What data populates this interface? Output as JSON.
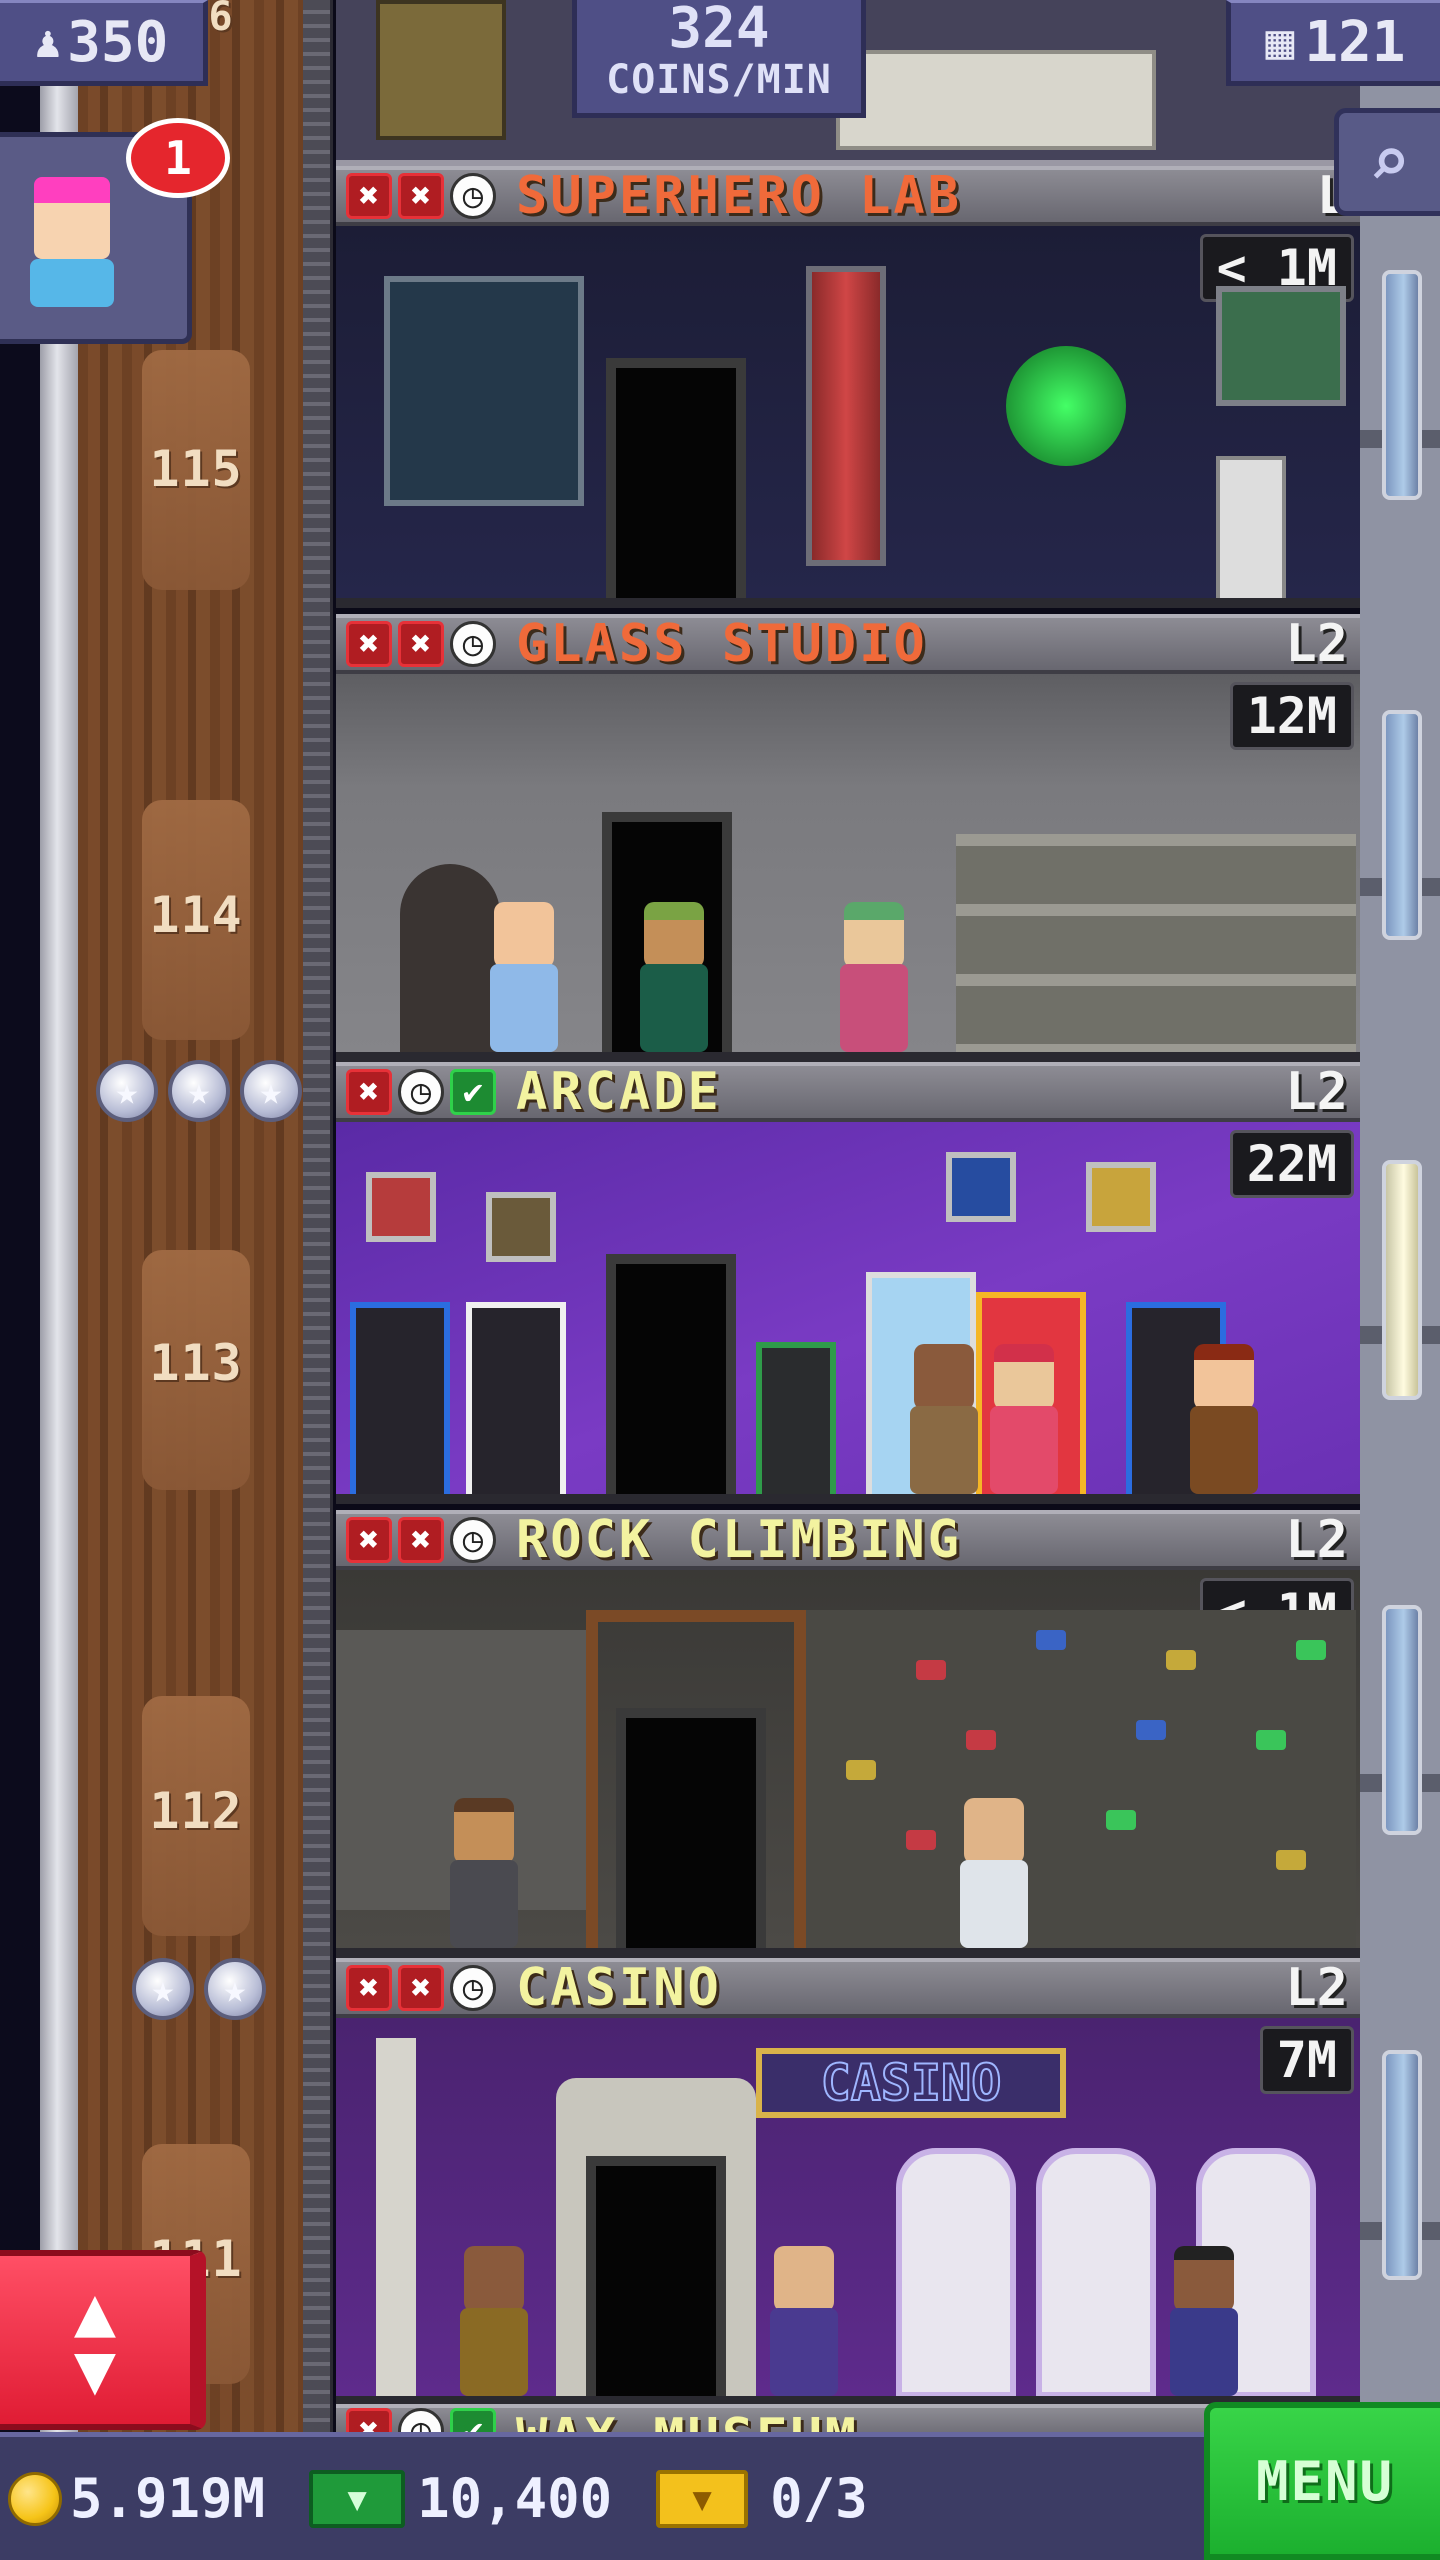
{
  "hud": {
    "population": "350",
    "population_icon": "person-up-icon",
    "coins_per_min_value": "324",
    "coins_per_min_unit": "COINS/MIN",
    "floors_count": "121",
    "floors_icon": "building-icon",
    "mission_badge_count": "1"
  },
  "shaft": {
    "floor_numbers": [
      "115",
      "114",
      "113",
      "112",
      "111"
    ],
    "partial_floor_top": "6"
  },
  "floors": [
    {
      "name": "SUPERHERO LAB",
      "level": "L",
      "earnings": "< 1M",
      "name_color": "#f06a3a",
      "status": [
        "x",
        "x",
        "clock"
      ]
    },
    {
      "name": "GLASS STUDIO",
      "level": "L2",
      "earnings": "12M",
      "name_color": "#f06a3a",
      "status": [
        "x",
        "x",
        "clock"
      ]
    },
    {
      "name": "ARCADE",
      "level": "L2",
      "earnings": "22M",
      "name_color": "#f3f3a0",
      "status": [
        "x",
        "clock",
        "check"
      ]
    },
    {
      "name": "ROCK CLIMBING",
      "level": "L2",
      "earnings": "< 1M",
      "name_color": "#f3f3a0",
      "status": [
        "x",
        "x",
        "clock"
      ]
    },
    {
      "name": "CASINO",
      "level": "L2",
      "earnings": "7M",
      "name_color": "#f3f3a0",
      "status": [
        "x",
        "x",
        "clock"
      ]
    }
  ],
  "casino_sign": "CASINO",
  "next_floor_partial": "WAX MUSEUM",
  "bottom": {
    "coins": "5.919M",
    "bux": "10,400",
    "tickets": "0/3",
    "menu_label": "MENU"
  },
  "colors": {
    "hud_bg": "#4f4f86",
    "menu_green": "#1cb02f",
    "elevator_red": "#e01c34",
    "badge_red": "#e5262d"
  }
}
